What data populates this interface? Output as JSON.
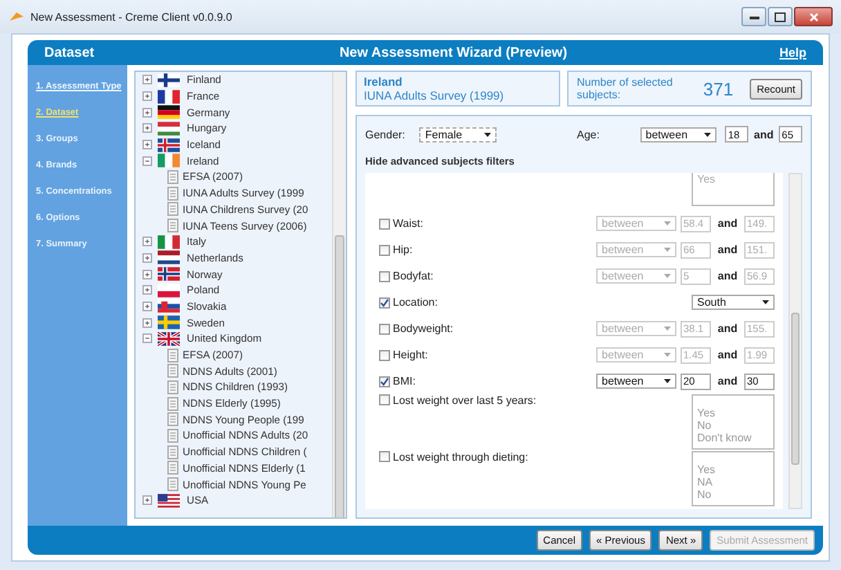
{
  "window": {
    "title": "New Assessment - Creme Client v0.0.9.0"
  },
  "header": {
    "section": "Dataset",
    "title": "New Assessment Wizard (Preview)",
    "help": "Help"
  },
  "steps": [
    {
      "label": "1. Assessment Type",
      "selected": false,
      "link": true
    },
    {
      "label": "2. Dataset",
      "selected": true,
      "link": true
    },
    {
      "label": "3. Groups",
      "selected": false,
      "link": false
    },
    {
      "label": "4. Brands",
      "selected": false,
      "link": false
    },
    {
      "label": "5. Concentrations",
      "selected": false,
      "link": false
    },
    {
      "label": "6. Options",
      "selected": false,
      "link": false
    },
    {
      "label": "7. Summary",
      "selected": false,
      "link": false
    }
  ],
  "tree": [
    {
      "label": "Finland",
      "expanded": false
    },
    {
      "label": "France",
      "expanded": false
    },
    {
      "label": "Germany",
      "expanded": false
    },
    {
      "label": "Hungary",
      "expanded": false
    },
    {
      "label": "Iceland",
      "expanded": false
    },
    {
      "label": "Ireland",
      "expanded": true,
      "children": [
        {
          "label": "EFSA (2007)"
        },
        {
          "label": "IUNA Adults Survey (1999"
        },
        {
          "label": "IUNA Childrens Survey (20"
        },
        {
          "label": "IUNA Teens Survey (2006)"
        }
      ]
    },
    {
      "label": "Italy",
      "expanded": false
    },
    {
      "label": "Netherlands",
      "expanded": false
    },
    {
      "label": "Norway",
      "expanded": false
    },
    {
      "label": "Poland",
      "expanded": false
    },
    {
      "label": "Slovakia",
      "expanded": false
    },
    {
      "label": "Sweden",
      "expanded": false
    },
    {
      "label": "United Kingdom",
      "expanded": true,
      "children": [
        {
          "label": "EFSA (2007)"
        },
        {
          "label": "NDNS Adults (2001)"
        },
        {
          "label": "NDNS Children (1993)"
        },
        {
          "label": "NDNS Elderly (1995)"
        },
        {
          "label": "NDNS Young People (199"
        },
        {
          "label": "Unofficial NDNS Adults (20"
        },
        {
          "label": "Unofficial NDNS Children ("
        },
        {
          "label": "Unofficial NDNS Elderly (1"
        },
        {
          "label": "Unofficial NDNS Young Pe"
        }
      ]
    },
    {
      "label": "USA",
      "expanded": false
    }
  ],
  "selection": {
    "country": "Ireland",
    "survey": "IUNA Adults Survey (1999)"
  },
  "count": {
    "label": "Number of selected subjects:",
    "value": "371",
    "button": "Recount"
  },
  "basic_filters": {
    "gender_label": "Gender:",
    "gender": "Female",
    "age_label": "Age:",
    "age_operator": "between",
    "age_min": "18",
    "and": "and",
    "age_max": "65"
  },
  "advanced_toggle": "Hide advanced subjects filters",
  "advanced_top_list": [
    "Yes"
  ],
  "advanced_filters": [
    {
      "kind": "range",
      "label": "Waist:",
      "checked": false,
      "operator": "between",
      "min": "58.4",
      "and": "and",
      "max": "149."
    },
    {
      "kind": "range",
      "label": "Hip:",
      "checked": false,
      "operator": "between",
      "min": "66",
      "and": "and",
      "max": "151."
    },
    {
      "kind": "range",
      "label": "Bodyfat:",
      "checked": false,
      "operator": "between",
      "min": "5",
      "and": "and",
      "max": "56.9"
    },
    {
      "kind": "choice",
      "label": "Location:",
      "checked": true,
      "value": "South"
    },
    {
      "kind": "range",
      "label": "Bodyweight:",
      "checked": false,
      "operator": "between",
      "min": "38.1",
      "and": "and",
      "max": "155."
    },
    {
      "kind": "range",
      "label": "Height:",
      "checked": false,
      "operator": "between",
      "min": "1.45",
      "and": "and",
      "max": "1.99"
    },
    {
      "kind": "range",
      "label": "BMI:",
      "checked": true,
      "operator": "between",
      "min": "20",
      "and": "and",
      "max": "30"
    },
    {
      "kind": "list",
      "label": "Lost weight over last 5 years:",
      "checked": false,
      "options": [
        "Yes",
        "No",
        "Don't know"
      ]
    },
    {
      "kind": "list",
      "label": "Lost weight through dieting:",
      "checked": false,
      "options": [
        "Yes",
        "NA",
        "No"
      ]
    }
  ],
  "buttons": [
    {
      "label": "Cancel",
      "disabled": false
    },
    {
      "label": "« Previous",
      "disabled": false
    },
    {
      "label": "Next »",
      "disabled": false
    },
    {
      "label": "Submit Assessment",
      "disabled": true
    }
  ]
}
